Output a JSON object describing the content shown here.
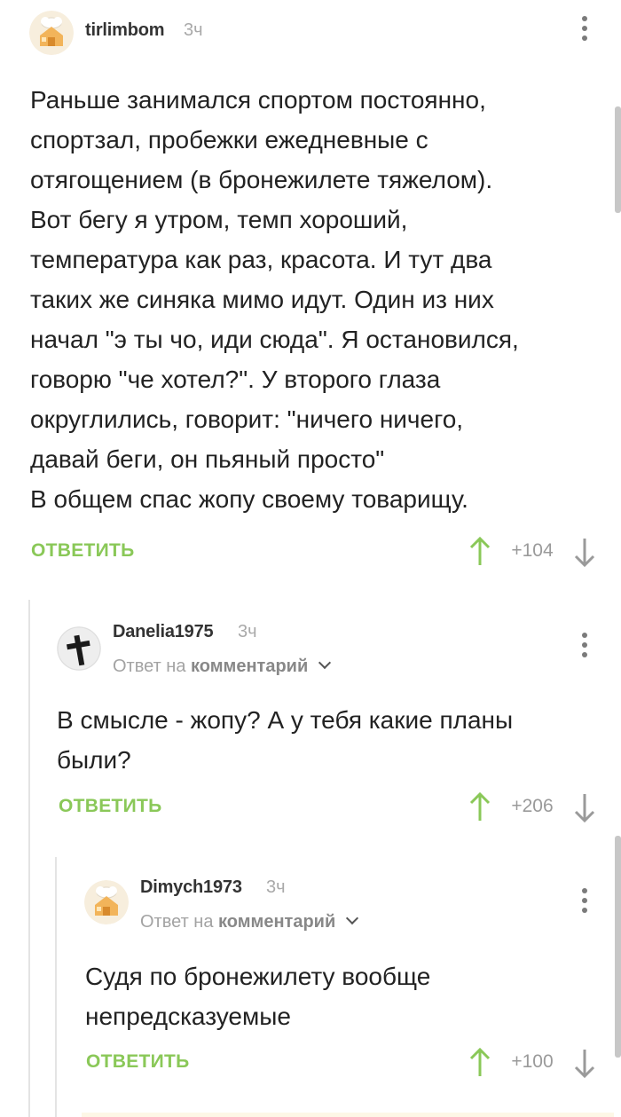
{
  "comments": [
    {
      "username": "tirlimbom",
      "time": "3ч",
      "avatar_icon": "chef-house-avatar-icon",
      "body": "Раньше занимался спортом постоянно,\nспортзал, пробежки ежедневные с\nотягощением (в бронежилете тяжелом).\nВот бегу я утром, темп хороший,\nтемпература как раз, красота. И тут два\nтаких же синяка мимо идут. Один из них\nначал \"э ты чо, иди сюда\". Я остановился,\nговорю \"че хотел?\". У второго глаза\nокруглились, говорит: \"ничего ничего,\nдавай беги, он пьяный просто\"\nВ общем спас жопу своему товарищу.",
      "reply_label": "ОТВЕТИТЬ",
      "rating": "+104"
    },
    {
      "username": "Danelia1975",
      "time": "3ч",
      "avatar_icon": "cross-avatar-icon",
      "reply_to_prefix": "Ответ на",
      "reply_to_link": "комментарий",
      "body": "В смысле - жопу? А у тебя какие планы\nбыли?",
      "reply_label": "ОТВЕТИТЬ",
      "rating": "+206"
    },
    {
      "username": "Dimych1973",
      "time": "3ч",
      "avatar_icon": "chef-house-avatar-icon",
      "reply_to_prefix": "Ответ на",
      "reply_to_link": "комментарий",
      "body": "Судя по бронежилету вообще\nнепредсказуемые",
      "reply_label": "ОТВЕТИТЬ",
      "rating": "+100"
    }
  ],
  "colors": {
    "accent_green": "#8ac858",
    "text": "#222222",
    "muted": "#a9a9a9",
    "thread_line": "#e4e4e4"
  }
}
